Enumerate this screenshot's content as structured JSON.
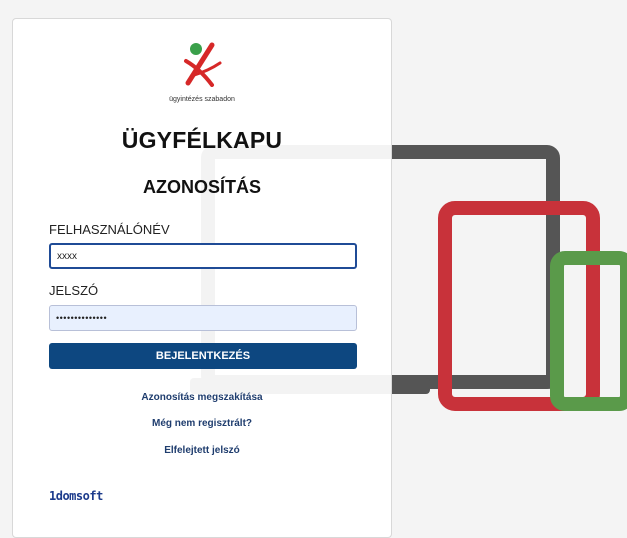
{
  "logo": {
    "tagline": "ügyintézés szabadon"
  },
  "page": {
    "title": "ÜGYFÉLKAPU",
    "subtitle": "AZONOSÍTÁS"
  },
  "form": {
    "username_label": "FELHASZNÁLÓNÉV",
    "username_value": "xxxx",
    "password_label": "JELSZÓ",
    "password_value": "••••••••••••••",
    "login_button": "BEJELENTKEZÉS"
  },
  "links": {
    "cancel": "Azonosítás megszakítása",
    "register": "Még nem regisztrált?",
    "forgot": "Elfelejtett jelszó"
  },
  "footer": {
    "brand": "1domsoft"
  },
  "colors": {
    "primary": "#0d4780",
    "laptop": "#555555",
    "tablet": "#c8323a",
    "phone": "#5a9a4a",
    "logo_green": "#3aa04a",
    "logo_red": "#d62828"
  },
  "icons": {
    "logo": "government-logo-icon",
    "background": "devices-illustration"
  }
}
